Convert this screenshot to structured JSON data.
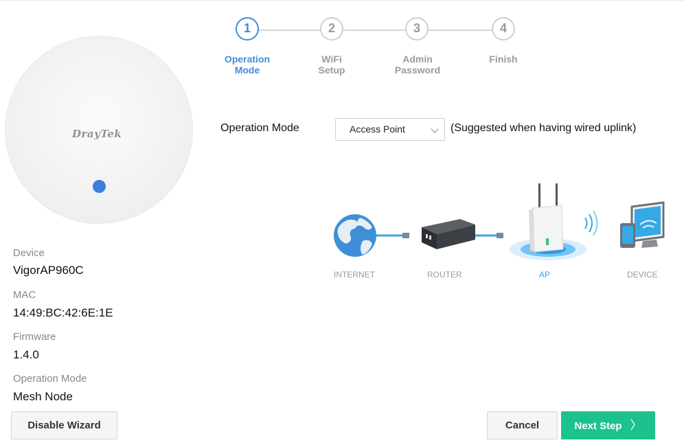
{
  "device_image": {
    "logo_text": "DrayTek",
    "led_color": "#3d7ddb"
  },
  "device_info": [
    {
      "label": "Device",
      "value": "VigorAP960C"
    },
    {
      "label": "MAC",
      "value": "14:49:BC:42:6E:1E"
    },
    {
      "label": "Firmware",
      "value": "1.4.0"
    },
    {
      "label": "Operation Mode",
      "value": "Mesh Node"
    }
  ],
  "wizard_steps": [
    {
      "number": "1",
      "label_line1": "Operation",
      "label_line2": "Mode",
      "active": true
    },
    {
      "number": "2",
      "label_line1": "WiFi",
      "label_line2": "Setup",
      "active": false
    },
    {
      "number": "3",
      "label_line1": "Admin",
      "label_line2": "Password",
      "active": false
    },
    {
      "number": "4",
      "label_line1": "Finish",
      "label_line2": "",
      "active": false
    }
  ],
  "operation_mode": {
    "label": "Operation Mode",
    "selected": "Access Point",
    "hint": "(Suggested when having wired uplink)"
  },
  "diagram": {
    "nodes": [
      "INTERNET",
      "ROUTER",
      "AP",
      "DEVICE"
    ],
    "active_node": "AP"
  },
  "buttons": {
    "disable_wizard": "Disable Wizard",
    "cancel": "Cancel",
    "next_step": "Next Step",
    "next_arrow": "〉"
  },
  "colors": {
    "accent": "#3b8fd8",
    "next_button": "#1cc28e",
    "ap_highlight": "#3b9fe0"
  }
}
